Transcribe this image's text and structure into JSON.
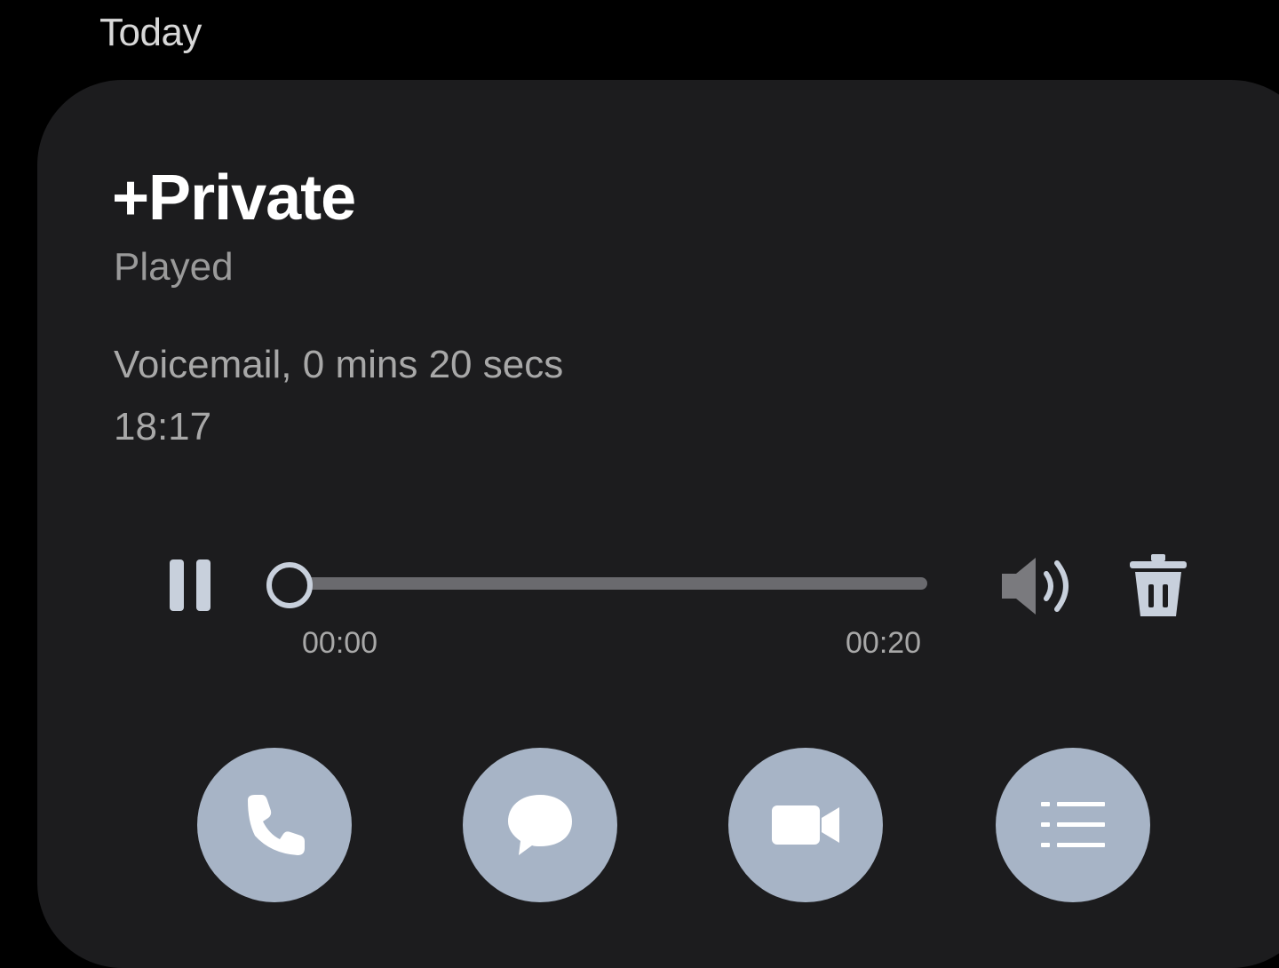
{
  "section": {
    "header": "Today"
  },
  "entry": {
    "caller": "+Private",
    "status": "Played",
    "detail": "Voicemail, 0 mins 20 secs",
    "time": "18:17"
  },
  "player": {
    "elapsed": "00:00",
    "duration": "00:20",
    "progress": 0,
    "icons": {
      "play_pause": "pause-icon",
      "speaker": "speaker-icon",
      "delete": "trash-icon"
    }
  },
  "actions": [
    {
      "icon": "phone-icon"
    },
    {
      "icon": "message-bubble-icon"
    },
    {
      "icon": "video-camera-icon"
    },
    {
      "icon": "list-details-icon"
    }
  ],
  "colors": {
    "background": "#000000",
    "card": "#1c1c1e",
    "accent": "#c8d0dc",
    "action_button": "#a7b4c6",
    "secondary_text": "#a8a8a8"
  }
}
